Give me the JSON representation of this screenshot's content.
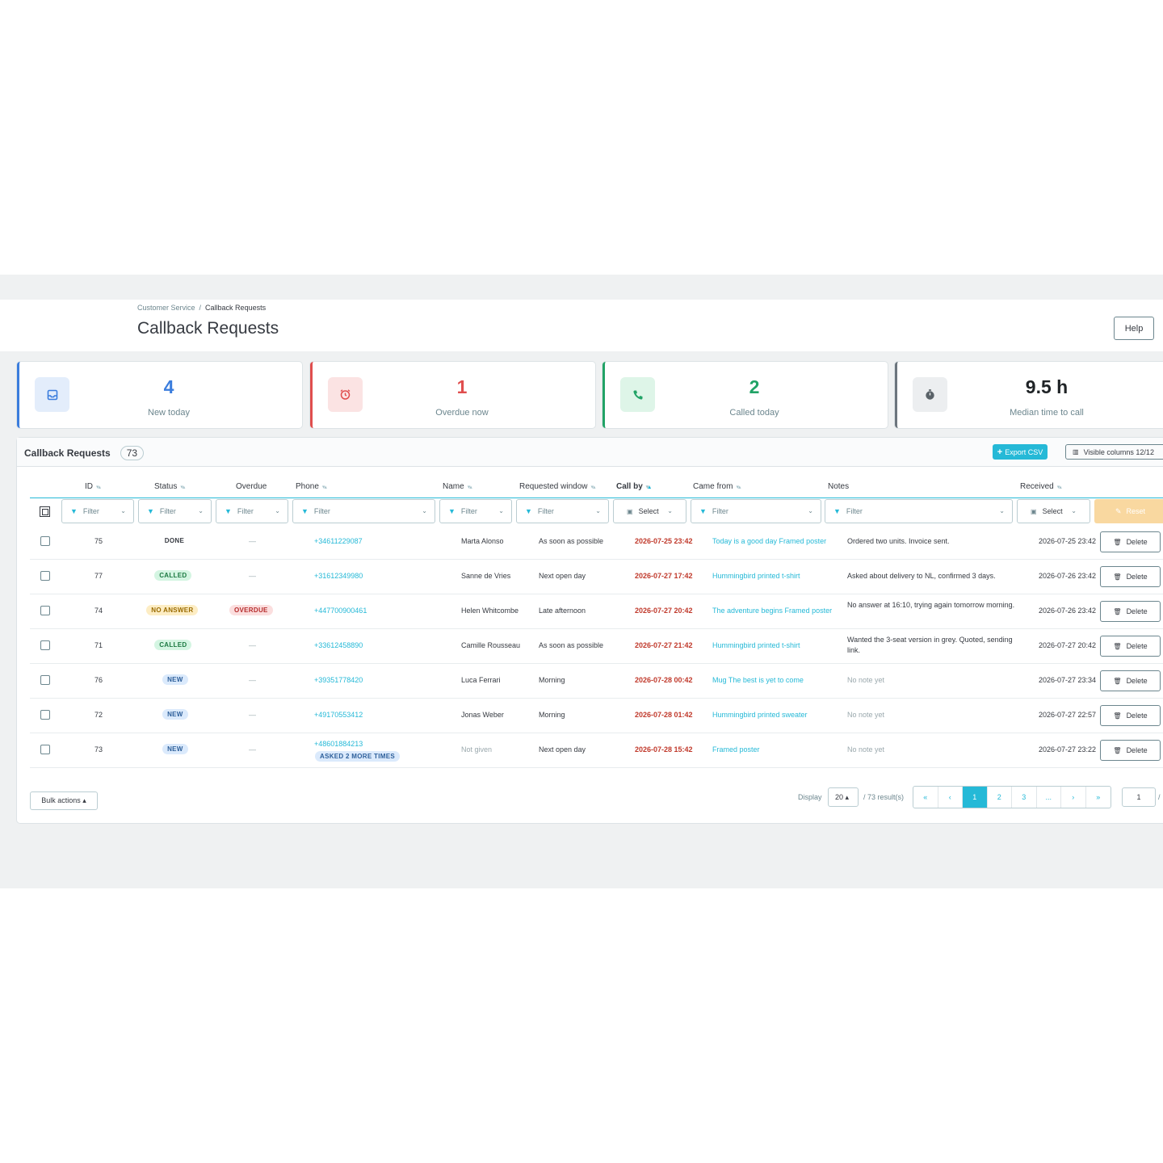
{
  "breadcrumb": {
    "parent": "Customer Service",
    "separator": "/",
    "current": "Callback Requests"
  },
  "page_title": "Callback Requests",
  "help_label": "Help",
  "kpis": [
    {
      "value": "4",
      "label": "New today",
      "color": "#3b7ddd",
      "icon": "inbox-icon"
    },
    {
      "value": "1",
      "label": "Overdue now",
      "color": "#e04e4e",
      "icon": "alarm-clock-icon"
    },
    {
      "value": "2",
      "label": "Called today",
      "color": "#21a366",
      "icon": "phone-icon"
    },
    {
      "value": "9.5 h",
      "label": "Median time to call",
      "color": "#6c757d",
      "icon": "stopwatch-icon"
    }
  ],
  "card": {
    "title": "Callback Requests",
    "count": "73",
    "export_label": "Export CSV",
    "columns_label": "Visible columns 12/12"
  },
  "columns": [
    "ID",
    "Status",
    "Overdue",
    "Phone",
    "Name",
    "Requested window",
    "Call by",
    "Came from",
    "Notes",
    "Received"
  ],
  "filters": {
    "filter": "Filter",
    "select": "Select",
    "reset": "Reset"
  },
  "rows": [
    {
      "id": "75",
      "status": "DONE",
      "overdue": "—",
      "phone": "+34611229087",
      "asked": "",
      "name": "Marta Alonso",
      "window": "As soon as possible",
      "call_by": "2026-07-25 23:42",
      "came_from": "Today is a good day Framed poster",
      "notes": "Ordered two units. Invoice sent.",
      "received": "2026-07-25 23:42"
    },
    {
      "id": "77",
      "status": "CALLED",
      "overdue": "—",
      "phone": "+31612349980",
      "asked": "",
      "name": "Sanne de Vries",
      "window": "Next open day",
      "call_by": "2026-07-27 17:42",
      "came_from": "Hummingbird printed t-shirt",
      "notes": "Asked about delivery to NL, confirmed 3 days.",
      "received": "2026-07-26 23:42"
    },
    {
      "id": "74",
      "status": "NO ANSWER",
      "overdue": "OVERDUE",
      "phone": "+447700900461",
      "asked": "",
      "name": "Helen Whitcombe",
      "window": "Late afternoon",
      "call_by": "2026-07-27 20:42",
      "came_from": "The adventure begins Framed poster",
      "notes": "No answer at 16:10, trying again tomorrow morning.",
      "received": "2026-07-26 23:42"
    },
    {
      "id": "71",
      "status": "CALLED",
      "overdue": "—",
      "phone": "+33612458890",
      "asked": "",
      "name": "Camille Rousseau",
      "window": "As soon as possible",
      "call_by": "2026-07-27 21:42",
      "came_from": "Hummingbird printed t-shirt",
      "notes": "Wanted the 3-seat version in grey. Quoted, sending link.",
      "received": "2026-07-27 20:42"
    },
    {
      "id": "76",
      "status": "NEW",
      "overdue": "—",
      "phone": "+39351778420",
      "asked": "",
      "name": "Luca Ferrari",
      "window": "Morning",
      "call_by": "2026-07-28 00:42",
      "came_from": "Mug The best is yet to come",
      "notes": "No note yet",
      "received": "2026-07-27 23:34"
    },
    {
      "id": "72",
      "status": "NEW",
      "overdue": "—",
      "phone": "+49170553412",
      "asked": "",
      "name": "Jonas Weber",
      "window": "Morning",
      "call_by": "2026-07-28 01:42",
      "came_from": "Hummingbird printed sweater",
      "notes": "No note yet",
      "received": "2026-07-27 22:57"
    },
    {
      "id": "73",
      "status": "NEW",
      "overdue": "—",
      "phone": "+48601884213",
      "asked": "ASKED 2 MORE TIMES",
      "name": "Not given",
      "window": "Next open day",
      "call_by": "2026-07-28 15:42",
      "came_from": "Framed poster",
      "notes": "No note yet",
      "received": "2026-07-27 23:22"
    }
  ],
  "delete_label": "Delete",
  "footer": {
    "bulk_label": "Bulk actions ▴",
    "display_label": "Display",
    "page_size": "20 ▴",
    "results": "/ 73 result(s)",
    "pages": [
      "«",
      "‹",
      "1",
      "2",
      "3",
      "...",
      "›",
      "»"
    ],
    "current_page": "1",
    "page_input": "1",
    "total_pages": "/"
  }
}
